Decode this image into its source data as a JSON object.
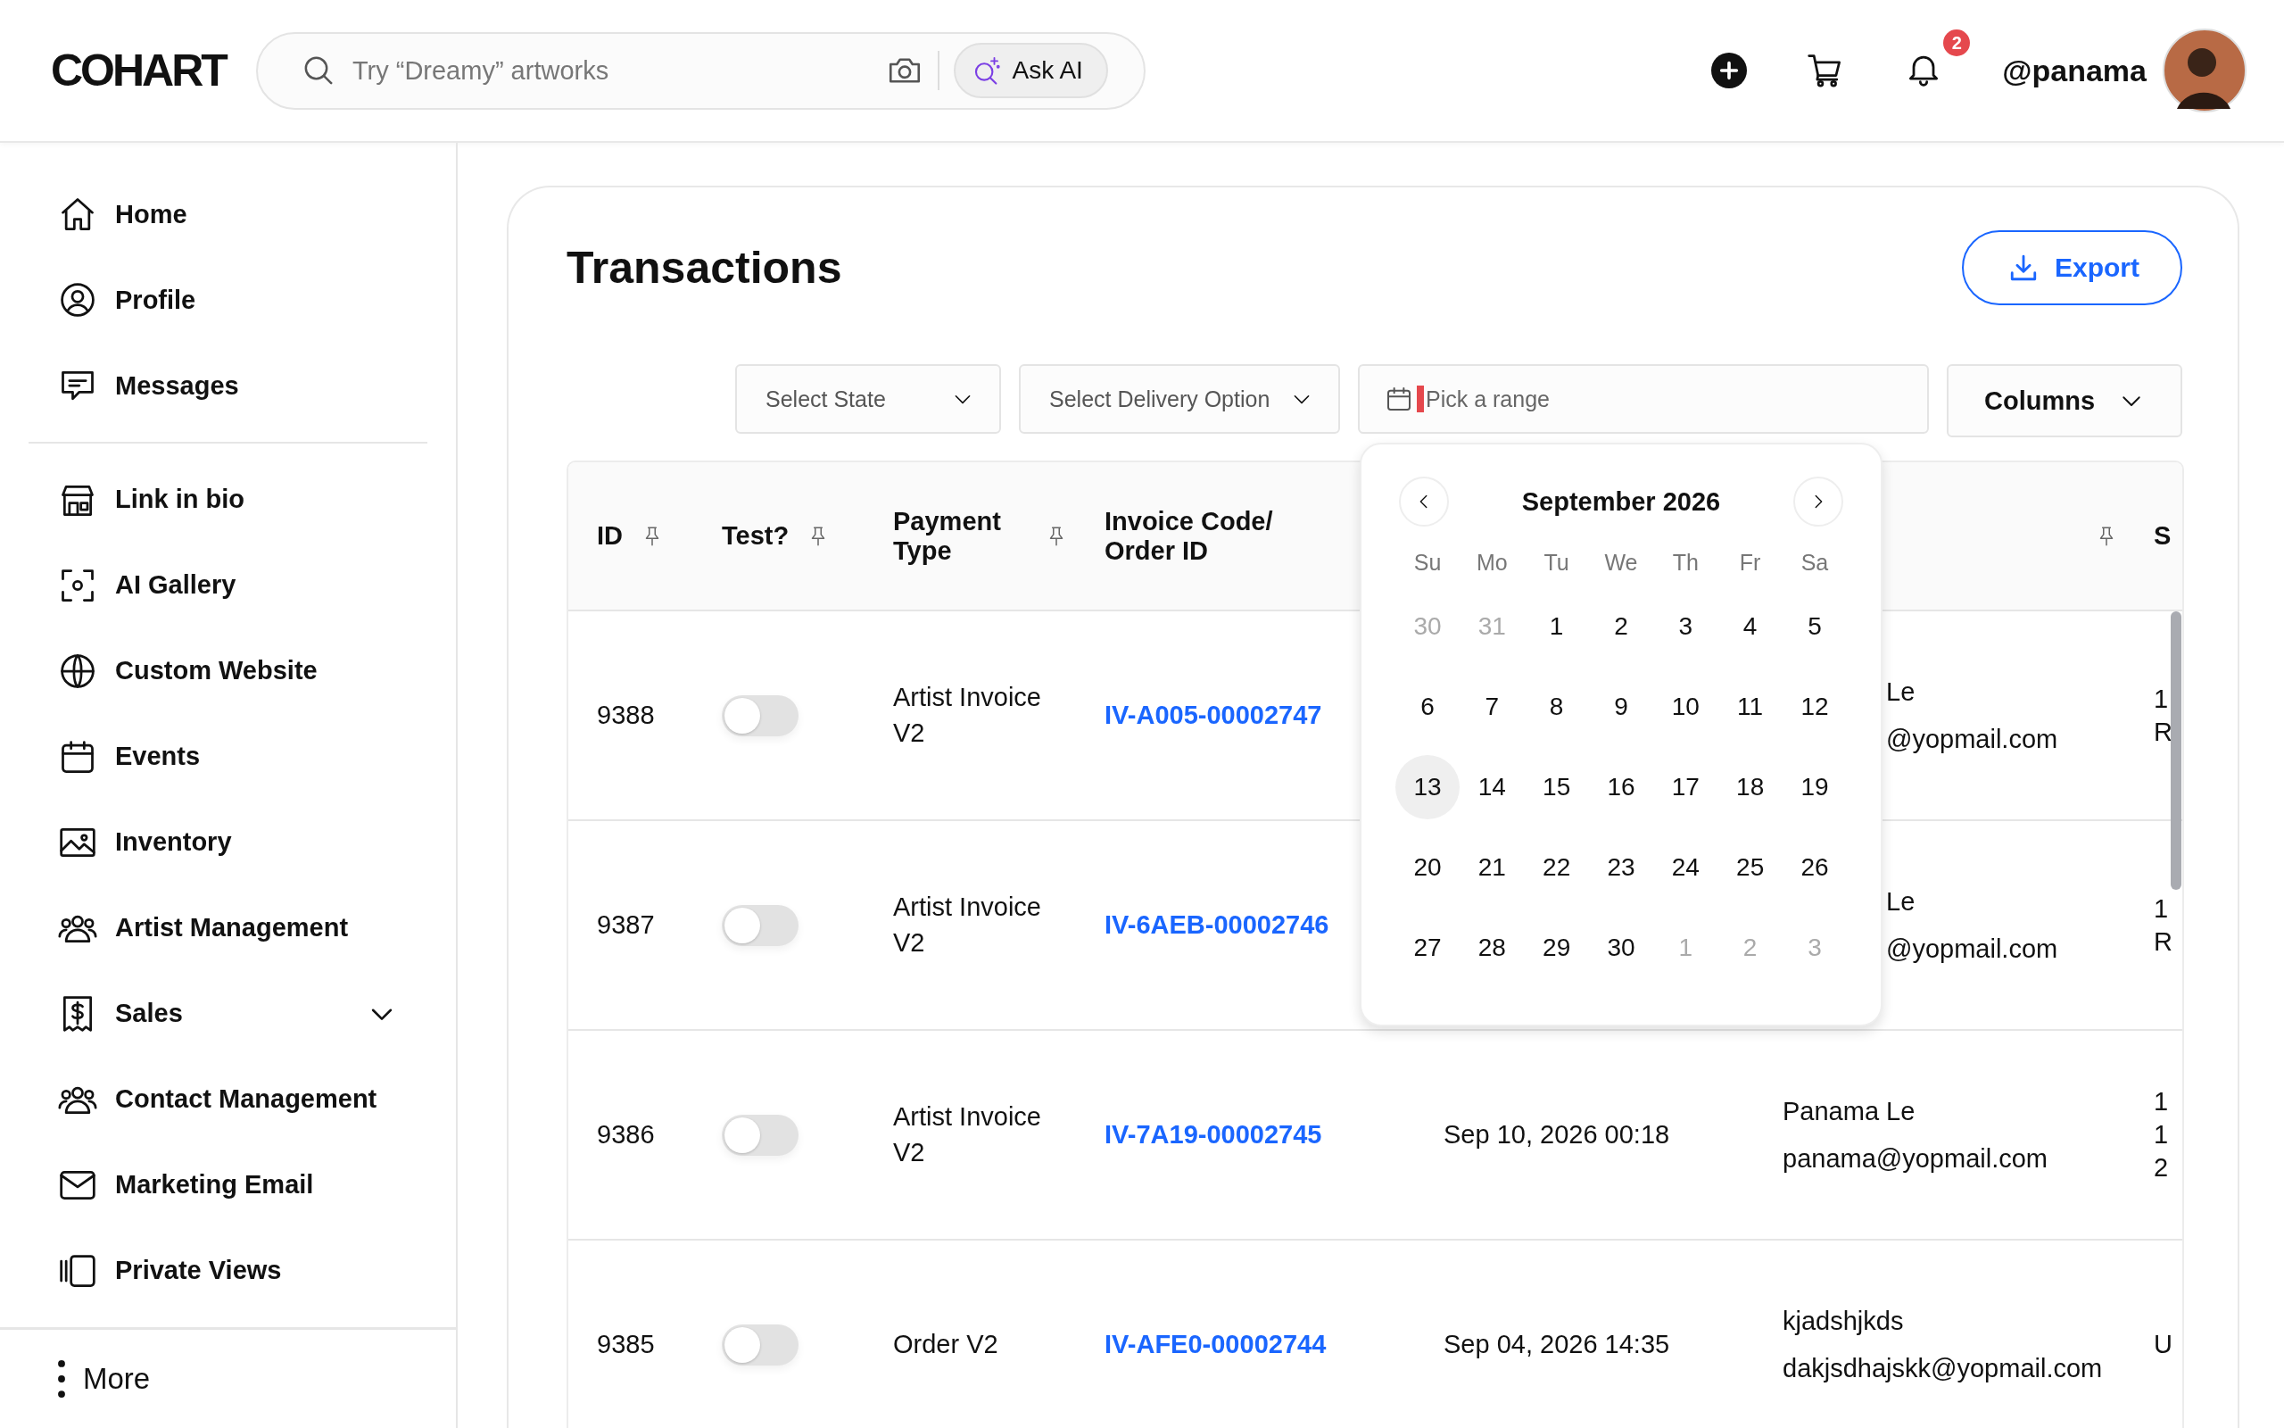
{
  "header": {
    "logo": "COHART",
    "search": {
      "placeholder": "Try “Dreamy” artworks"
    },
    "ask_ai": "Ask AI",
    "notification_count": "2",
    "username": "@panama"
  },
  "sidebar": {
    "sections": [
      {
        "items": [
          {
            "label": "Home",
            "kind": "link"
          },
          {
            "label": "Profile",
            "kind": "link"
          },
          {
            "label": "Messages",
            "kind": "link"
          }
        ]
      },
      {
        "items": [
          {
            "label": "Link in bio",
            "kind": "link"
          },
          {
            "label": "AI Gallery",
            "kind": "link"
          },
          {
            "label": "Custom Website",
            "kind": "link"
          },
          {
            "label": "Events",
            "kind": "link"
          },
          {
            "label": "Inventory",
            "kind": "link"
          },
          {
            "label": "Artist Management",
            "kind": "link"
          },
          {
            "label": "Sales",
            "kind": "group",
            "expanded": false
          },
          {
            "label": "Contact Management",
            "kind": "link"
          },
          {
            "label": "Marketing Email",
            "kind": "link"
          },
          {
            "label": "Private Views",
            "kind": "link"
          }
        ]
      }
    ],
    "more": "More"
  },
  "page": {
    "title": "Transactions",
    "export": "Export",
    "filters": [
      {
        "kind": "select",
        "label": "Select State"
      },
      {
        "kind": "select",
        "label": "Select Delivery Option"
      },
      {
        "kind": "date",
        "placeholder": "Pick a range",
        "focused": true
      },
      {
        "kind": "button",
        "label": "Columns"
      }
    ],
    "calendar": {
      "month": "September 2026",
      "weekdays": [
        "Su",
        "Mo",
        "Tu",
        "We",
        "Th",
        "Fr",
        "Sa"
      ],
      "days": [
        {
          "label": "30",
          "outside": true,
          "selected": false
        },
        {
          "label": "31",
          "outside": true,
          "selected": false
        },
        {
          "label": "1",
          "outside": false,
          "selected": false
        },
        {
          "label": "2",
          "outside": false,
          "selected": false
        },
        {
          "label": "3",
          "outside": false,
          "selected": false
        },
        {
          "label": "4",
          "outside": false,
          "selected": false
        },
        {
          "label": "5",
          "outside": false,
          "selected": false
        },
        {
          "label": "6",
          "outside": false,
          "selected": false
        },
        {
          "label": "7",
          "outside": false,
          "selected": false
        },
        {
          "label": "8",
          "outside": false,
          "selected": false
        },
        {
          "label": "9",
          "outside": false,
          "selected": false
        },
        {
          "label": "10",
          "outside": false,
          "selected": false
        },
        {
          "label": "11",
          "outside": false,
          "selected": false
        },
        {
          "label": "12",
          "outside": false,
          "selected": false
        },
        {
          "label": "13",
          "outside": false,
          "selected": true
        },
        {
          "label": "14",
          "outside": false,
          "selected": false
        },
        {
          "label": "15",
          "outside": false,
          "selected": false
        },
        {
          "label": "16",
          "outside": false,
          "selected": false
        },
        {
          "label": "17",
          "outside": false,
          "selected": false
        },
        {
          "label": "18",
          "outside": false,
          "selected": false
        },
        {
          "label": "19",
          "outside": false,
          "selected": false
        },
        {
          "label": "20",
          "outside": false,
          "selected": false
        },
        {
          "label": "21",
          "outside": false,
          "selected": false
        },
        {
          "label": "22",
          "outside": false,
          "selected": false
        },
        {
          "label": "23",
          "outside": false,
          "selected": false
        },
        {
          "label": "24",
          "outside": false,
          "selected": false
        },
        {
          "label": "25",
          "outside": false,
          "selected": false
        },
        {
          "label": "26",
          "outside": false,
          "selected": false
        },
        {
          "label": "27",
          "outside": false,
          "selected": false
        },
        {
          "label": "28",
          "outside": false,
          "selected": false
        },
        {
          "label": "29",
          "outside": false,
          "selected": false
        },
        {
          "label": "30",
          "outside": false,
          "selected": false
        },
        {
          "label": "1",
          "outside": true,
          "selected": false
        },
        {
          "label": "2",
          "outside": true,
          "selected": false
        },
        {
          "label": "3",
          "outside": true,
          "selected": false
        }
      ]
    },
    "table": {
      "columns": [
        {
          "label": "ID",
          "pinned": true
        },
        {
          "label": "Test?",
          "pinned": true
        },
        {
          "label": "Payment Type",
          "pinned": true
        },
        {
          "label": "Invoice Code/ Order ID",
          "pinned": false
        },
        {},
        {
          "pinned": true
        },
        {
          "label": "S",
          "pinned": false
        }
      ],
      "rows": [
        {
          "id": "9388",
          "test": false,
          "payment_type": "Artist Invoice V2",
          "invoice": "IV-A005-00002747",
          "customer_covered": true,
          "customer_name": "Le",
          "customer_email": "@yopmail.com",
          "column_7": [
            "1",
            "R"
          ]
        },
        {
          "id": "9387",
          "test": false,
          "payment_type": "Artist Invoice V2",
          "invoice": "IV-6AEB-00002746",
          "customer_covered": true,
          "customer_name": "Le",
          "customer_email": "@yopmail.com",
          "column_7": [
            "1",
            "R"
          ]
        },
        {
          "id": "9386",
          "test": false,
          "payment_type": "Artist Invoice V2",
          "invoice": "IV-7A19-00002745",
          "customer_covered": false,
          "date": "Sep 10, 2026 00:18",
          "customer_name": "Panama Le",
          "customer_email": "panama@yopmail.com",
          "column_7": [
            "1",
            "1",
            "2"
          ]
        },
        {
          "id": "9385",
          "test": false,
          "payment_type": "Order V2",
          "invoice": "IV-AFE0-00002744",
          "customer_covered": false,
          "date": "Sep 04, 2026 14:35",
          "customer_name": "kjadshjkds",
          "customer_email": "dakjsdhajskk@yopmail.com",
          "column_7": [
            "U"
          ]
        }
      ]
    }
  }
}
